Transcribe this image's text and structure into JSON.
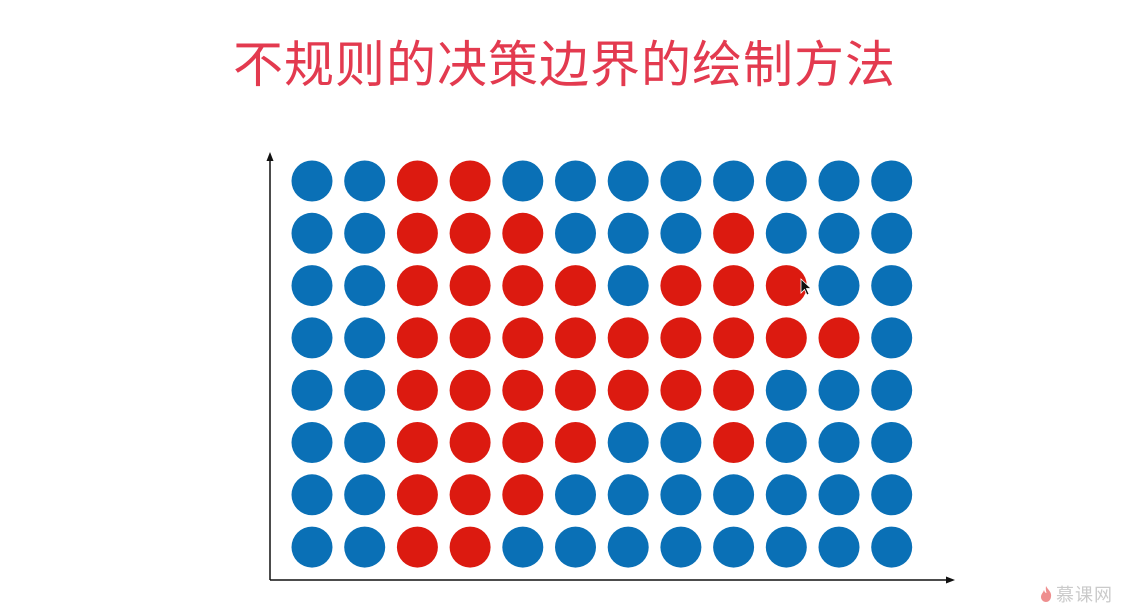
{
  "slide": {
    "title": "不规则的决策边界的绘制方法"
  },
  "watermark": {
    "text": "慕课网"
  },
  "colors": {
    "title": "#e33a4f",
    "blue": "#0a70b6",
    "red": "#dc1a10",
    "axis": "#111111",
    "watermark": "#e96a6a",
    "watermark_text": "#b9b9b9"
  },
  "chart_data": {
    "type": "scatter",
    "title": "",
    "xlabel": "",
    "ylabel": "",
    "grid": false,
    "legend": "none",
    "rows_top_to_bottom": [
      [
        "blue",
        "blue",
        "red",
        "red",
        "blue",
        "blue",
        "blue",
        "blue",
        "blue",
        "blue",
        "blue",
        "blue"
      ],
      [
        "blue",
        "blue",
        "red",
        "red",
        "red",
        "blue",
        "blue",
        "blue",
        "red",
        "blue",
        "blue",
        "blue"
      ],
      [
        "blue",
        "blue",
        "red",
        "red",
        "red",
        "red",
        "blue",
        "red",
        "red",
        "red",
        "blue",
        "blue"
      ],
      [
        "blue",
        "blue",
        "red",
        "red",
        "red",
        "red",
        "red",
        "red",
        "red",
        "red",
        "red",
        "blue"
      ],
      [
        "blue",
        "blue",
        "red",
        "red",
        "red",
        "red",
        "red",
        "red",
        "red",
        "blue",
        "blue",
        "blue"
      ],
      [
        "blue",
        "blue",
        "red",
        "red",
        "red",
        "red",
        "blue",
        "blue",
        "red",
        "blue",
        "blue",
        "blue"
      ],
      [
        "blue",
        "blue",
        "red",
        "red",
        "red",
        "blue",
        "blue",
        "blue",
        "blue",
        "blue",
        "blue",
        "blue"
      ],
      [
        "blue",
        "blue",
        "red",
        "red",
        "blue",
        "blue",
        "blue",
        "blue",
        "blue",
        "blue",
        "blue",
        "blue"
      ]
    ]
  }
}
